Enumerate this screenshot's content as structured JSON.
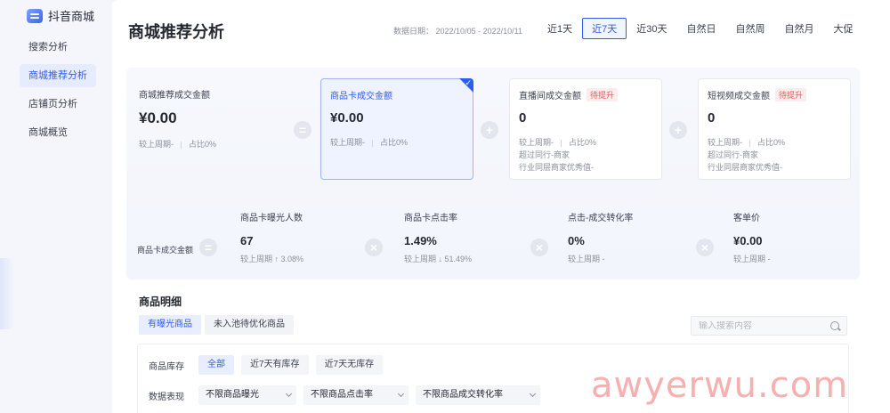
{
  "app": {
    "name": "抖音商城"
  },
  "sidebar": {
    "items": [
      {
        "label": "搜索分析",
        "active": false
      },
      {
        "label": "商城推荐分析",
        "active": true
      },
      {
        "label": "店铺页分析",
        "active": false
      },
      {
        "label": "商城概览",
        "active": false
      }
    ]
  },
  "header": {
    "title": "商城推荐分析",
    "date_label": "数据日期：",
    "date_range": "2022/10/05 - 2022/10/11",
    "range_tabs": [
      "近1天",
      "近7天",
      "近30天",
      "自然日",
      "自然周",
      "自然月",
      "大促"
    ],
    "active_range": "近7天"
  },
  "cards": [
    {
      "title": "商城推荐成交金额",
      "value": "¥0.00",
      "meta1": "较上周期-",
      "meta2": "占比0%"
    },
    {
      "title": "商品卡成交金额",
      "value": "¥0.00",
      "meta1": "较上周期-",
      "meta2": "占比0%"
    },
    {
      "title": "直播间成交金额",
      "tag": "待提升",
      "value": "0",
      "meta1": "较上周期-",
      "meta2": "占比0%",
      "meta3": "超过同行-商家",
      "meta4": "行业同层商家优秀值-"
    },
    {
      "title": "短视频成交金额",
      "tag": "待提升",
      "value": "0",
      "meta1": "较上周期-",
      "meta2": "占比0%",
      "meta3": "超过同行-商家",
      "meta4": "行业同层商家优秀值-"
    }
  ],
  "operators": {
    "equals": "=",
    "plus": "+",
    "times": "×"
  },
  "breakdown": {
    "label": "商品卡成交金额",
    "metrics": [
      {
        "title": "商品卡曝光人数",
        "value": "67",
        "meta": "较上周期 ↑ 3.08%"
      },
      {
        "title": "商品卡点击率",
        "value": "1.49%",
        "meta": "较上周期 ↓ 51.49%"
      },
      {
        "title": "点击-成交转化率",
        "value": "0%",
        "meta": "较上周期 -"
      },
      {
        "title": "客单价",
        "value": "¥0.00",
        "meta": "较上周期 -"
      }
    ]
  },
  "goods": {
    "title": "商品明细",
    "tabs": [
      "有曝光商品",
      "未入池待优化商品"
    ],
    "active_tab": "有曝光商品",
    "search_placeholder": "输入搜索内容",
    "stock_label": "商品库存",
    "stock_options": [
      "全部",
      "近7天有库存",
      "近7天无库存"
    ],
    "active_stock": "全部",
    "perf_label": "数据表现",
    "perf_selects": [
      "不限商品曝光",
      "不限商品点击率",
      "不限商品成交转化率"
    ]
  },
  "watermark": "awyerwu.com",
  "colors": {
    "accent": "#2f5cf0",
    "tag_red": "#f0545a"
  },
  "icons": {
    "search": "search-icon",
    "check": "check-icon",
    "chevron": "chevron-down-icon"
  }
}
